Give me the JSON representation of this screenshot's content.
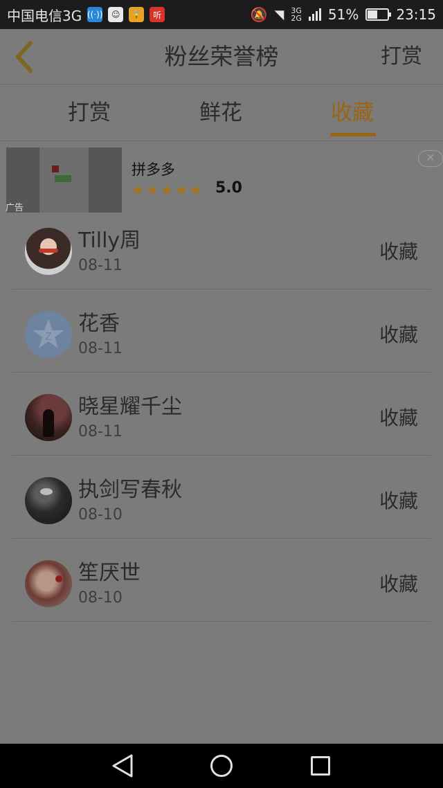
{
  "status_bar": {
    "carrier": "中国电信3G",
    "apps": [
      "wifi-hotspot-icon",
      "chat-icon",
      "lock-app-icon",
      "listen-app-icon"
    ],
    "app_listen_label": "听",
    "network_type": "3G/2G",
    "battery_percent": "51%",
    "time": "23:15"
  },
  "header": {
    "title": "粉丝荣誉榜",
    "right_action": "打赏"
  },
  "tabs": [
    {
      "label": "打赏",
      "active": false
    },
    {
      "label": "鲜花",
      "active": false
    },
    {
      "label": "收藏",
      "active": true
    }
  ],
  "ad": {
    "tag": "广告",
    "app_name": "拼多多",
    "stars": 5,
    "rating": "5.0"
  },
  "fans": [
    {
      "name": "Tilly周",
      "date": "08-11",
      "action": "收藏"
    },
    {
      "name": "花香",
      "date": "08-11",
      "action": "收藏"
    },
    {
      "name": "晓星耀千尘",
      "date": "08-11",
      "action": "收藏"
    },
    {
      "name": "执剑写春秋",
      "date": "08-10",
      "action": "收藏"
    },
    {
      "name": "笙厌世",
      "date": "08-10",
      "action": "收藏"
    }
  ],
  "colors": {
    "accent": "#9a6512",
    "overlay_background": "#7b7b7b"
  }
}
